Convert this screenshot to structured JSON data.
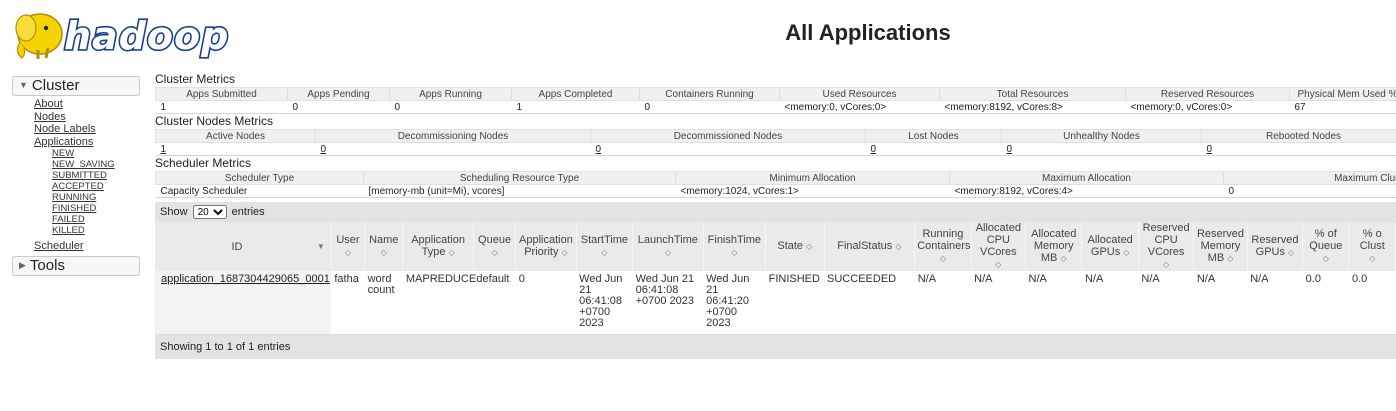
{
  "header": {
    "logo_text": "hadoop",
    "title": "All Applications"
  },
  "sidebar": {
    "cluster_label": "Cluster",
    "cluster_links": [
      "About",
      "Nodes",
      "Node Labels",
      "Applications"
    ],
    "app_states": [
      "NEW",
      "NEW_SAVING",
      "SUBMITTED",
      "ACCEPTED",
      "RUNNING",
      "FINISHED",
      "FAILED",
      "KILLED"
    ],
    "scheduler_label": "Scheduler",
    "tools_label": "Tools"
  },
  "cluster_metrics": {
    "title": "Cluster Metrics",
    "headers": [
      "Apps Submitted",
      "Apps Pending",
      "Apps Running",
      "Apps Completed",
      "Containers Running",
      "Used Resources",
      "Total Resources",
      "Reserved Resources",
      "Physical Mem Used %"
    ],
    "values": [
      "1",
      "0",
      "0",
      "1",
      "0",
      "<memory:0, vCores:0>",
      "<memory:8192, vCores:8>",
      "<memory:0, vCores:0>",
      "67"
    ]
  },
  "nodes_metrics": {
    "title": "Cluster Nodes Metrics",
    "headers": [
      "Active Nodes",
      "Decommissioning Nodes",
      "Decommissioned Nodes",
      "Lost Nodes",
      "Unhealthy Nodes",
      "Rebooted Nodes"
    ],
    "values": [
      "1",
      "0",
      "0",
      "0",
      "0",
      "0"
    ]
  },
  "scheduler_metrics": {
    "title": "Scheduler Metrics",
    "headers": [
      "Scheduler Type",
      "Scheduling Resource Type",
      "Minimum Allocation",
      "Maximum Allocation",
      "Maximum Clust"
    ],
    "values": [
      "Capacity Scheduler",
      "[memory-mb (unit=Mi), vcores]",
      "<memory:1024, vCores:1>",
      "<memory:8192, vCores:4>",
      "0"
    ]
  },
  "apps_table": {
    "show_label": "Show",
    "entries_label": "entries",
    "page_size": "20",
    "columns": [
      "ID",
      "User",
      "Name",
      "Application Type",
      "Queue",
      "Application Priority",
      "StartTime",
      "LaunchTime",
      "FinishTime",
      "State",
      "FinalStatus",
      "Running Containers",
      "Allocated CPU VCores",
      "Allocated Memory MB",
      "Allocated GPUs",
      "Reserved CPU VCores",
      "Reserved Memory MB",
      "Reserved GPUs",
      "% of Queue",
      "% o Clust"
    ],
    "rows": [
      {
        "id": "application_1687304429065_0001",
        "user": "fatha",
        "name": "word count",
        "type": "MAPREDUCE",
        "queue": "default",
        "priority": "0",
        "start": "Wed Jun 21 06:41:08 +0700 2023",
        "launch": "Wed Jun 21 06:41:08 +0700 2023",
        "finish": "Wed Jun 21 06:41:20 +0700 2023",
        "state": "FINISHED",
        "final_status": "SUCCEEDED",
        "running_containers": "N/A",
        "alloc_vcores": "N/A",
        "alloc_mem": "N/A",
        "alloc_gpus": "N/A",
        "res_vcores": "N/A",
        "res_mem": "N/A",
        "res_gpus": "N/A",
        "pct_queue": "0.0",
        "pct_cluster": "0.0"
      }
    ],
    "footer": {
      "prefix": "Showing",
      "from": "1",
      "to_word": "to",
      "to": "1",
      "of_word": "of",
      "total": "1",
      "suffix": "entries"
    }
  },
  "colors": {
    "logo_yellow": "#f5d300",
    "logo_blue": "#1a3f8f",
    "header_bg": "#eaeaea"
  }
}
